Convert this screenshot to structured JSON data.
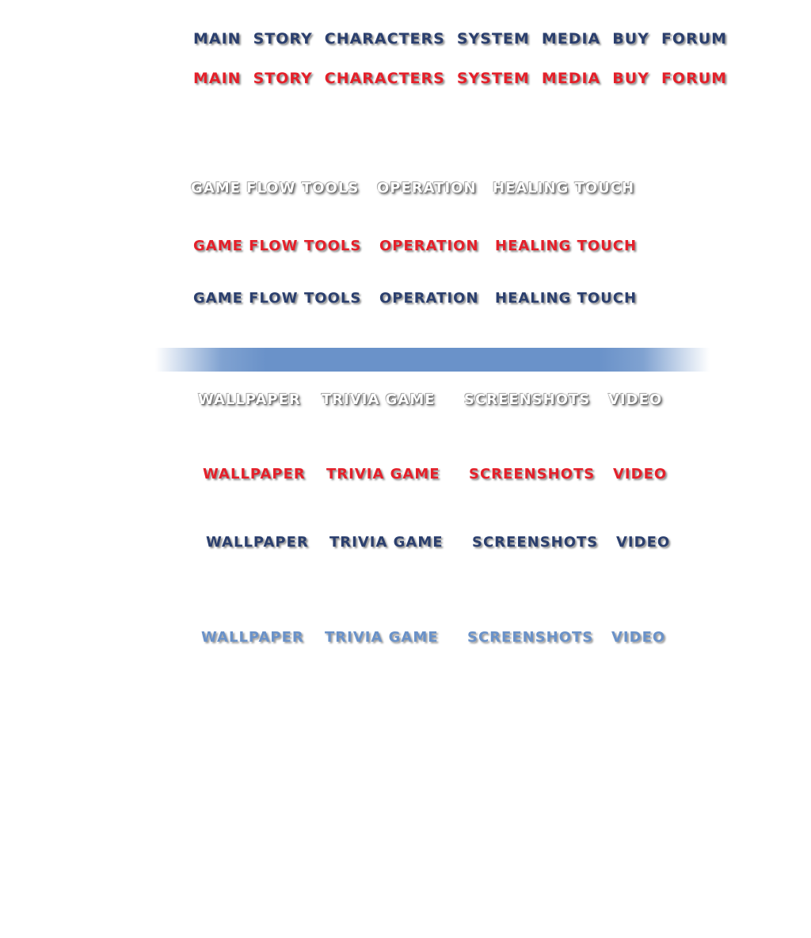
{
  "nav": {
    "items": [
      "MAIN",
      "STORY",
      "CHARACTERS",
      "SYSTEM",
      "MEDIA",
      "BUY",
      "FORUM"
    ]
  },
  "system_nav": {
    "items": [
      "GAME FLOW",
      "TOOLS",
      "OPERATION",
      "HEALING TOUCH"
    ]
  },
  "media_nav": {
    "items": [
      "WALLPAPER",
      "TRIVIA GAME",
      "SCREENSHOTS",
      "VIDEO"
    ]
  },
  "colors": {
    "navy": "#2b3f6e",
    "red": "#e4202a",
    "white": "#ffffff",
    "light_blue": "#6a92c9",
    "divider_bar": "#6a92c9"
  }
}
